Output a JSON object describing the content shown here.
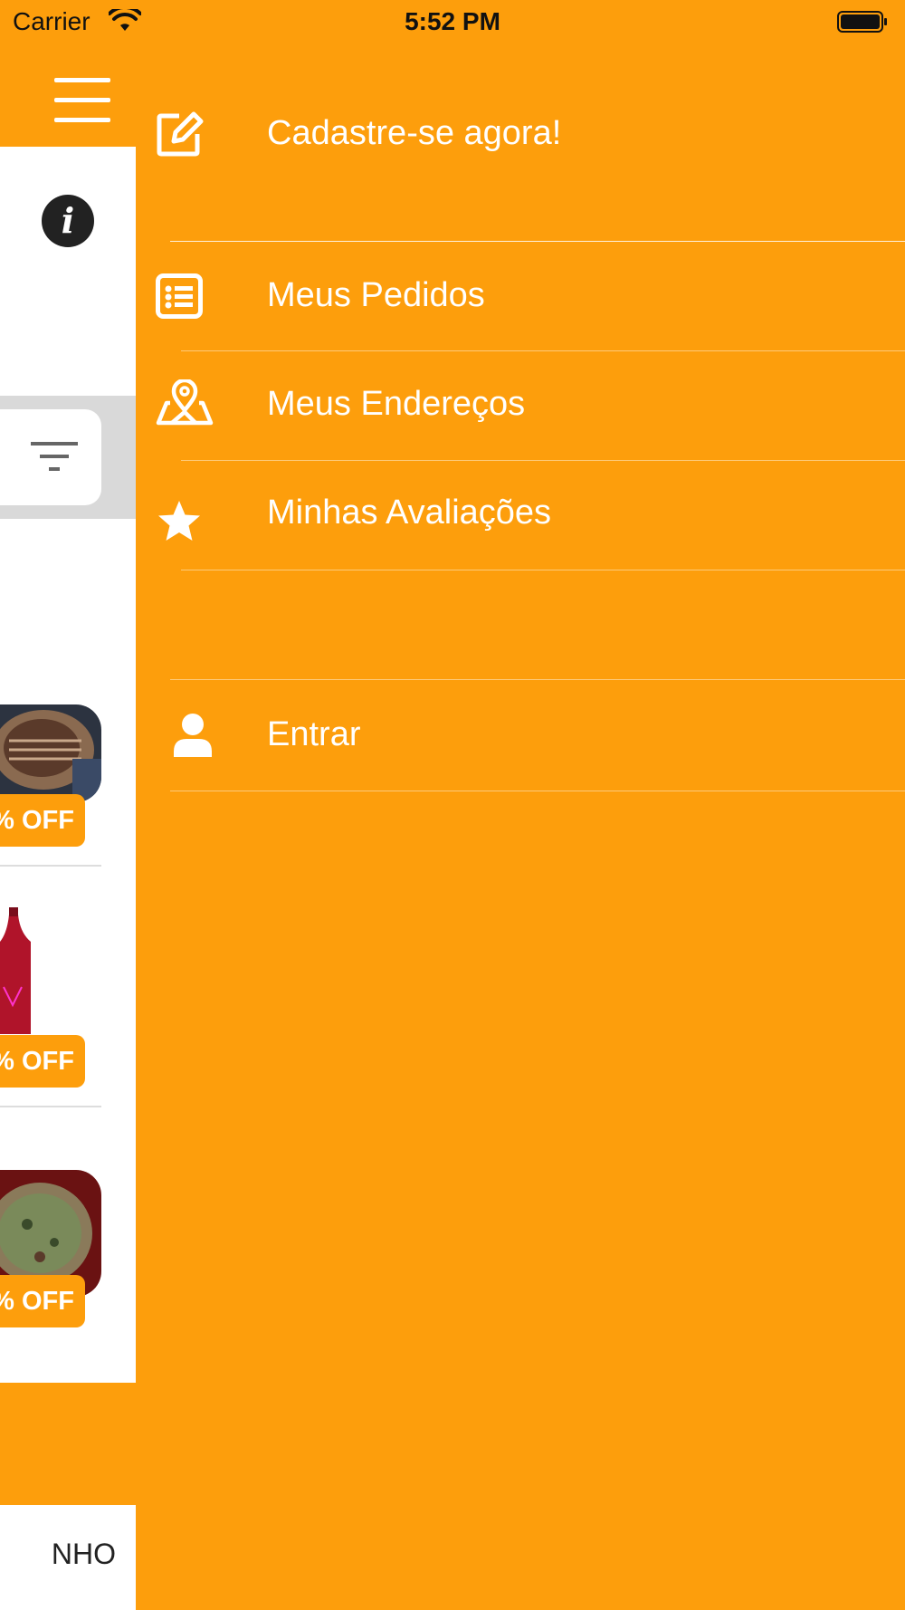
{
  "status_bar": {
    "carrier": "Carrier",
    "time": "5:52 PM"
  },
  "main": {
    "promos": [
      {
        "badge": "% OFF"
      },
      {
        "badge": "% OFF"
      },
      {
        "badge": "% OFF"
      }
    ],
    "bottom_tab_label": "NHO"
  },
  "drawer": {
    "register_label": "Cadastre-se agora!",
    "items": [
      {
        "label": "Meus Pedidos",
        "icon": "list-icon"
      },
      {
        "label": "Meus Endereços",
        "icon": "map-pin-icon"
      },
      {
        "label": "Minhas Avaliações",
        "icon": "star-icon"
      }
    ],
    "login_label": "Entrar"
  },
  "colors": {
    "accent": "#FD9E0C",
    "surface": "#FFFFFF"
  }
}
